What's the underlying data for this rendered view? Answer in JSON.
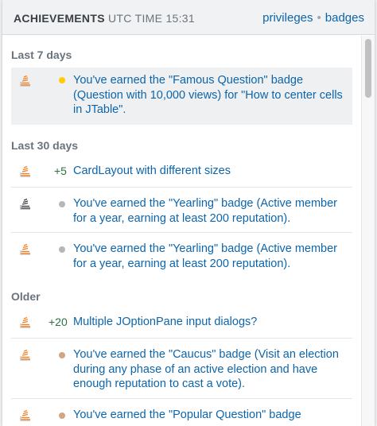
{
  "header": {
    "title": "ACHIEVEMENTS",
    "time": "UTC TIME 15:31",
    "privileges_label": "privileges",
    "separator": "•",
    "badges_label": "badges"
  },
  "colors": {
    "link": "#0c65ab",
    "rep_green": "#2f6f44",
    "gold": "#ffcc01",
    "silver": "#b4b8bc",
    "bronze": "#d1a684",
    "icon_orange": "#f48024"
  },
  "sections": [
    {
      "label": "Last 7 days",
      "items": [
        {
          "icon": "achievement-icon-orange",
          "kind": "badge",
          "badge_color": "gold",
          "text": "You've earned the \"Famous Question\" badge (Question with 10,000 views) for \"How to center cells in JTable\"."
        }
      ]
    },
    {
      "label": "Last 30 days",
      "items": [
        {
          "icon": "achievement-icon-orange",
          "kind": "rep",
          "rep": "+5",
          "text": "CardLayout with different sizes"
        },
        {
          "icon": "achievement-icon-gray",
          "kind": "badge",
          "badge_color": "silver",
          "text": "You've earned the \"Yearling\" badge (Active member for a year, earning at least 200 reputation)."
        },
        {
          "icon": "achievement-icon-orange",
          "kind": "badge",
          "badge_color": "silver",
          "text": "You've earned the \"Yearling\" badge (Active member for a year, earning at least 200 reputation)."
        }
      ]
    },
    {
      "label": "Older",
      "items": [
        {
          "icon": "achievement-icon-orange",
          "kind": "rep",
          "rep": "+20",
          "text": "Multiple JOptionPane input dialogs?"
        },
        {
          "icon": "achievement-icon-orange",
          "kind": "badge",
          "badge_color": "bronze",
          "text": "You've earned the \"Caucus\" badge (Visit an election during any phase of an active election and have enough reputation to cast a vote)."
        },
        {
          "icon": "achievement-icon-orange",
          "kind": "badge",
          "badge_color": "bronze",
          "text": "You've earned the \"Popular Question\" badge"
        }
      ]
    }
  ]
}
